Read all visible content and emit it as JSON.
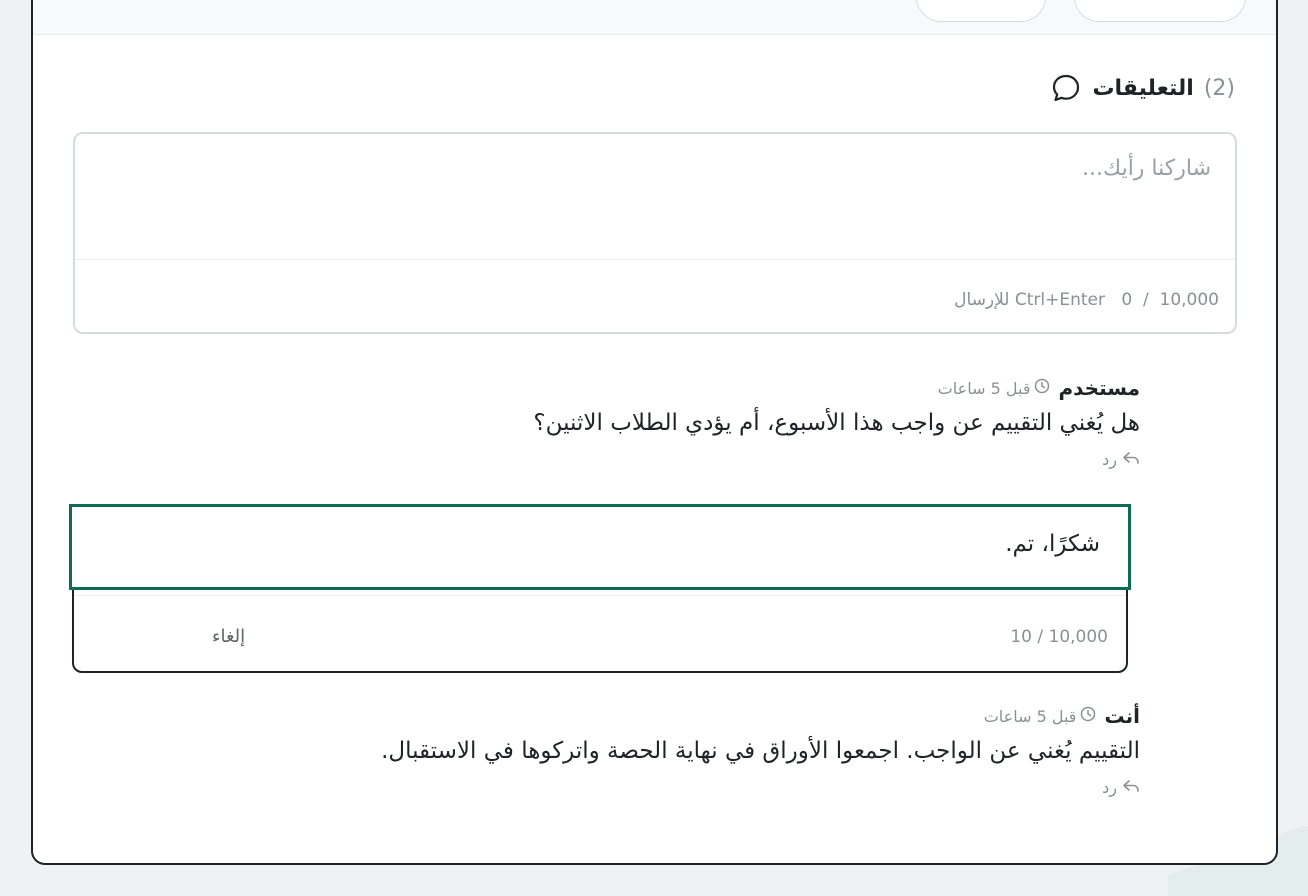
{
  "comments_section": {
    "title": "التعليقات",
    "count": "(2)",
    "icon": "comment-bubble-icon"
  },
  "composer": {
    "placeholder": "شاركنا رأيك...",
    "counter": "0  /  10,000",
    "hint": "Ctrl+Enter للإرسال"
  },
  "comments": [
    {
      "author": "مستخدم",
      "time": "قبل 5 ساعات",
      "body": "هل يُغني التقييم عن واجب هذا الأسبوع، أم يؤدي الطلاب الاثنين؟",
      "reply_label": "رد"
    },
    {
      "author": "أنت",
      "time": "قبل 5 ساعات",
      "body": "التقييم يُغني عن الواجب. اجمعوا الأوراق في نهاية الحصة واتركوها في الاستقبال.",
      "reply_label": "رد"
    }
  ],
  "reply_editor": {
    "value": "شكرًا، تم.",
    "counter": "10 / 10,000",
    "cancel_label": "إلغاء"
  },
  "colors": {
    "accent": "#0f6b58",
    "muted": "#8a9196",
    "border": "#1f2328"
  }
}
